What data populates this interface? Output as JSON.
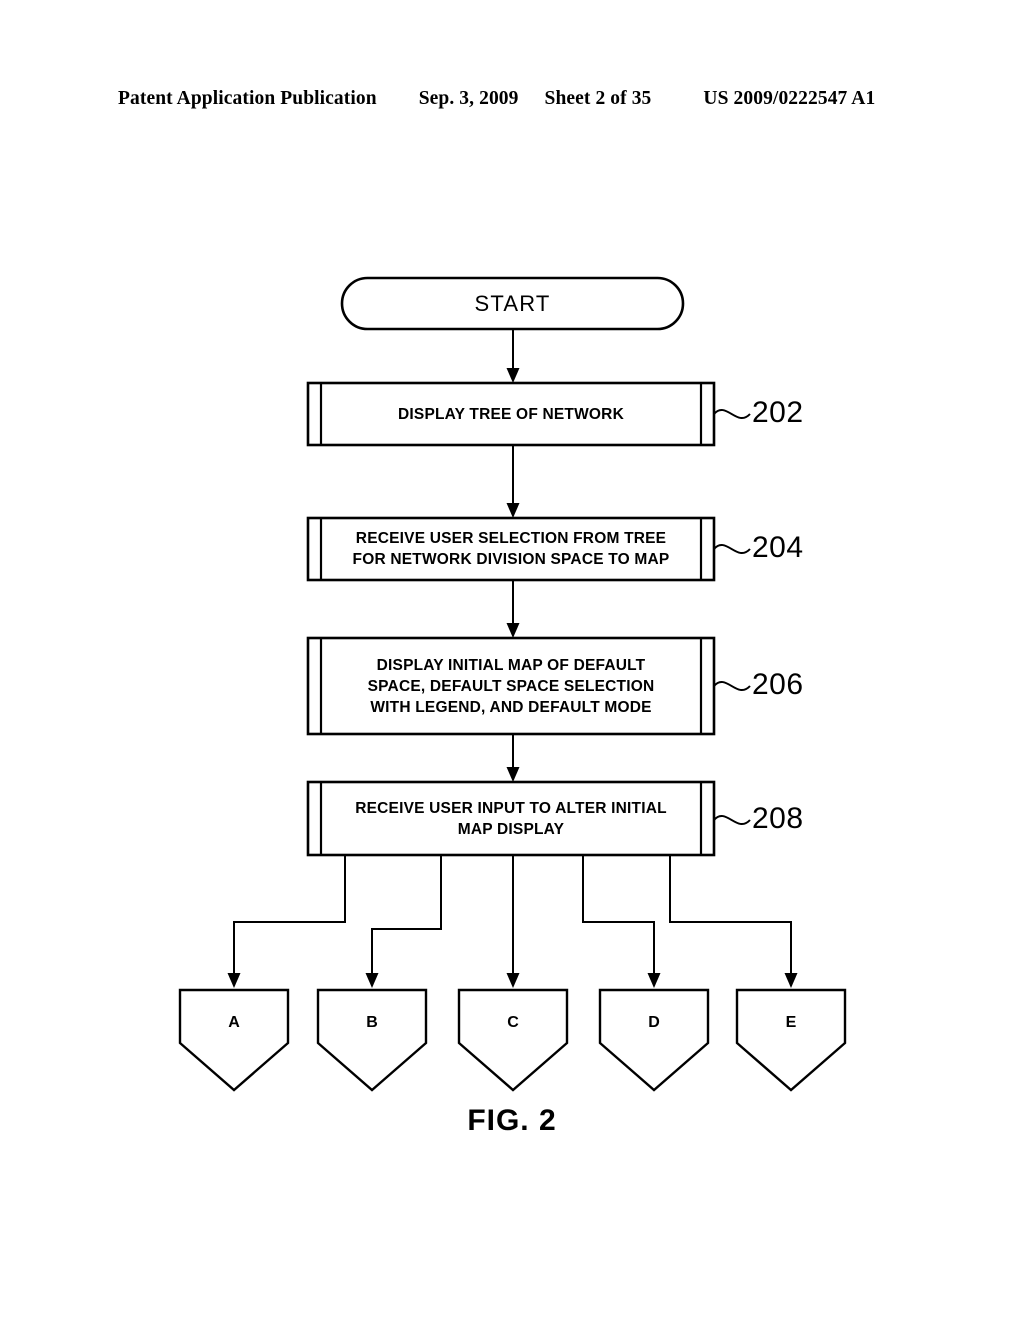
{
  "header": {
    "publication": "Patent Application Publication",
    "date": "Sep. 3, 2009",
    "sheet": "Sheet 2 of 35",
    "document_number": "US 2009/0222547 A1"
  },
  "figure": {
    "caption": "FIG. 2",
    "line_color": "#000000",
    "fill_color": "#ffffff"
  },
  "flowchart": {
    "terminator": {
      "label": "START",
      "shape": "stadium"
    },
    "steps": [
      {
        "ref": "202",
        "shape": "predefined-process",
        "text": "DISPLAY TREE OF NETWORK"
      },
      {
        "ref": "204",
        "shape": "predefined-process",
        "text": "RECEIVE USER SELECTION FROM TREE\nFOR NETWORK DIVISION SPACE TO MAP"
      },
      {
        "ref": "206",
        "shape": "predefined-process",
        "text": "DISPLAY INITIAL MAP OF DEFAULT\nSPACE, DEFAULT SPACE SELECTION\nWITH LEGEND, AND DEFAULT MODE"
      },
      {
        "ref": "208",
        "shape": "predefined-process",
        "text": "RECEIVE USER INPUT TO ALTER INITIAL\nMAP DISPLAY"
      }
    ],
    "connectors": [
      {
        "label": "A",
        "shape": "off-page-connector"
      },
      {
        "label": "B",
        "shape": "off-page-connector"
      },
      {
        "label": "C",
        "shape": "off-page-connector"
      },
      {
        "label": "D",
        "shape": "off-page-connector"
      },
      {
        "label": "E",
        "shape": "off-page-connector"
      }
    ]
  }
}
